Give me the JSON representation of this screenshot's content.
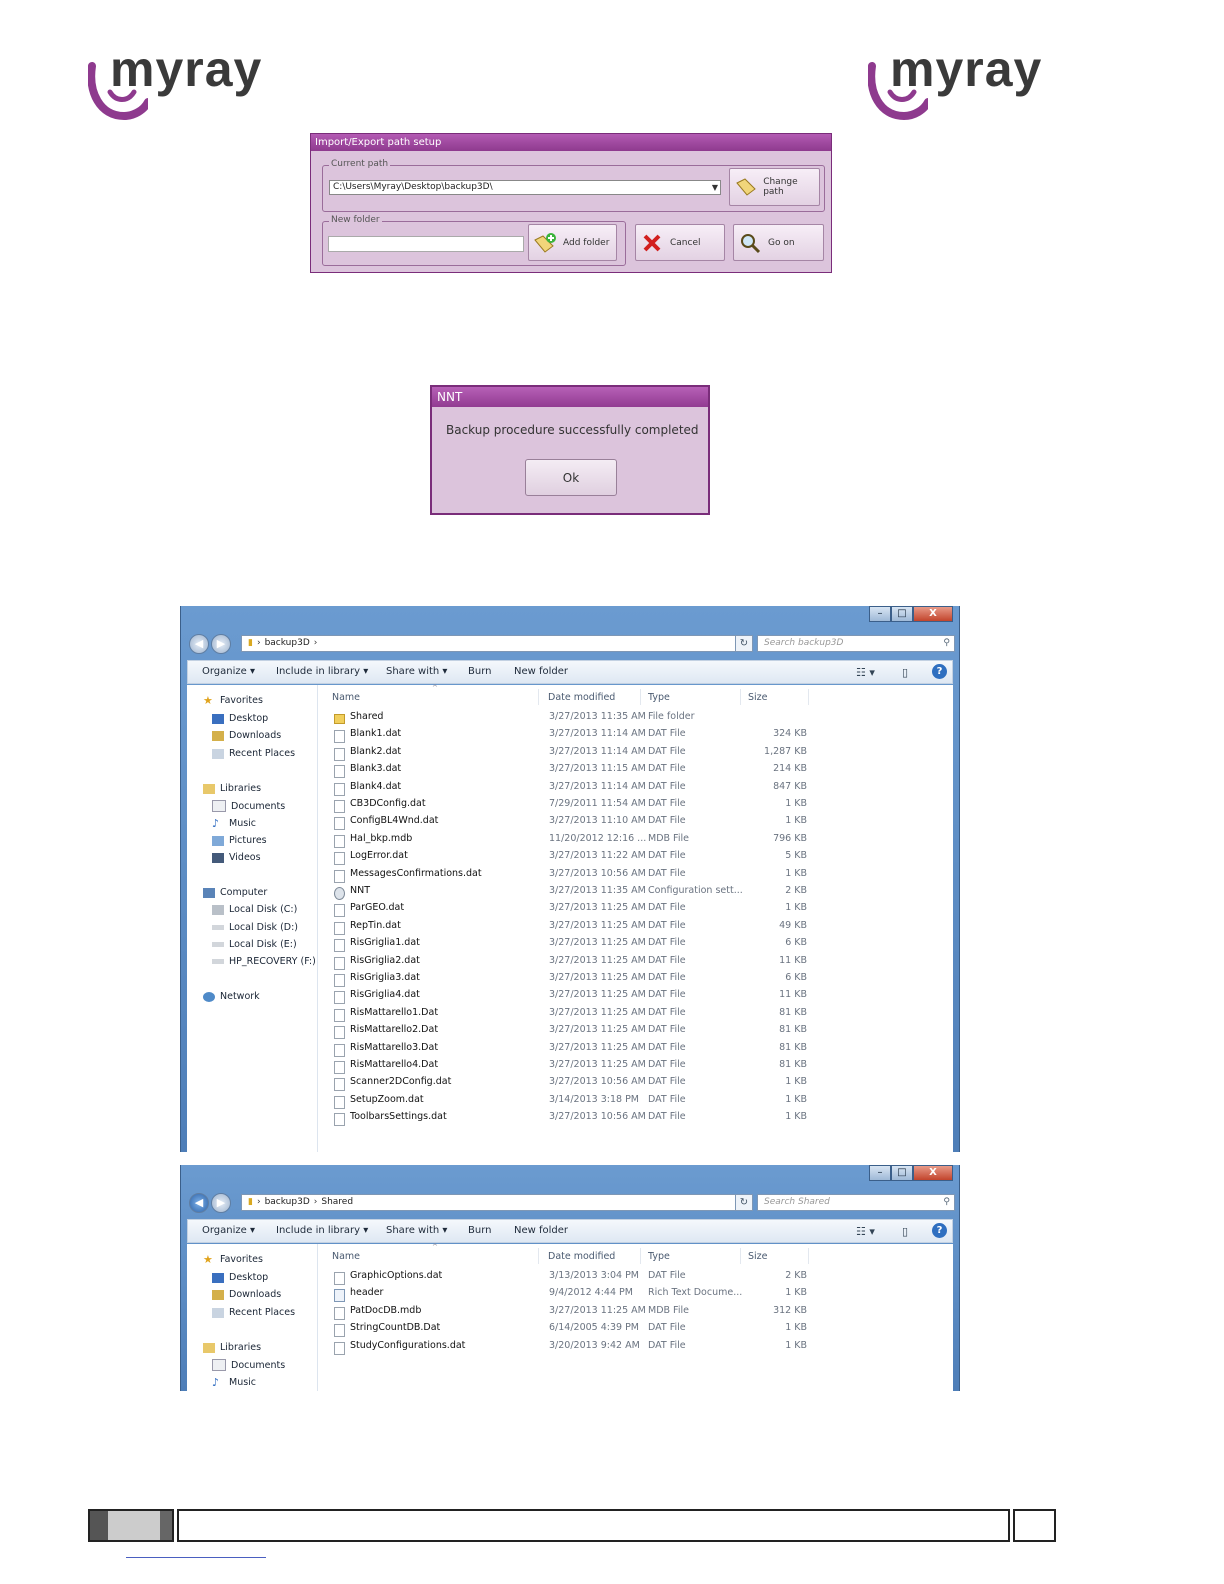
{
  "brand": {
    "logo_text": "myray",
    "logo_color": "#8e3a8e"
  },
  "import_export_dialog": {
    "title": "Import/Export path setup",
    "current_path_label": "Current path",
    "current_path_value": "C:\\Users\\Myray\\Desktop\\backup3D\\",
    "change_path_button": "Change path",
    "new_folder_label": "New folder",
    "new_folder_value": "",
    "add_folder_button": "Add folder",
    "cancel_button": "Cancel",
    "go_on_button": "Go on"
  },
  "message_dialog": {
    "title": "NNT",
    "message": "Backup procedure successfully completed",
    "ok_button": "Ok"
  },
  "explorer": {
    "window_buttons": {
      "minimize": "–",
      "maximize": "□",
      "close": "X"
    },
    "commands": {
      "organize": "Organize ▾",
      "include_in_library": "Include in library ▾",
      "share_with": "Share with ▾",
      "burn": "Burn",
      "new_folder": "New folder",
      "help": "?"
    },
    "columns": {
      "name": "Name",
      "date": "Date modified",
      "type": "Type",
      "size": "Size"
    },
    "nav_pane": {
      "favorites": "Favorites",
      "desktop": "Desktop",
      "downloads": "Downloads",
      "recent_places": "Recent Places",
      "libraries": "Libraries",
      "documents": "Documents",
      "music": "Music",
      "pictures": "Pictures",
      "videos": "Videos",
      "computer": "Computer",
      "disk_c": "Local Disk (C:)",
      "disk_d": "Local Disk (D:)",
      "disk_e": "Local Disk (E:)",
      "recovery": "HP_RECOVERY (F:)",
      "network": "Network"
    }
  },
  "window1": {
    "breadcrumb": [
      "backup3D"
    ],
    "search_placeholder": "Search backup3D",
    "files": [
      {
        "name": "Shared",
        "date": "3/27/2013 11:35 AM",
        "type": "File folder",
        "size": "",
        "icon": "folder-icon"
      },
      {
        "name": "Blank1.dat",
        "date": "3/27/2013 11:14 AM",
        "type": "DAT File",
        "size": "324 KB",
        "icon": "file-icon"
      },
      {
        "name": "Blank2.dat",
        "date": "3/27/2013 11:14 AM",
        "type": "DAT File",
        "size": "1,287 KB",
        "icon": "file-icon"
      },
      {
        "name": "Blank3.dat",
        "date": "3/27/2013 11:15 AM",
        "type": "DAT File",
        "size": "214 KB",
        "icon": "file-icon"
      },
      {
        "name": "Blank4.dat",
        "date": "3/27/2013 11:14 AM",
        "type": "DAT File",
        "size": "847 KB",
        "icon": "file-icon"
      },
      {
        "name": "CB3DConfig.dat",
        "date": "7/29/2011 11:54 AM",
        "type": "DAT File",
        "size": "1 KB",
        "icon": "file-icon"
      },
      {
        "name": "ConfigBL4Wnd.dat",
        "date": "3/27/2013 11:10 AM",
        "type": "DAT File",
        "size": "1 KB",
        "icon": "file-icon"
      },
      {
        "name": "Hal_bkp.mdb",
        "date": "11/20/2012 12:16 ...",
        "type": "MDB File",
        "size": "796 KB",
        "icon": "file-icon"
      },
      {
        "name": "LogError.dat",
        "date": "3/27/2013 11:22 AM",
        "type": "DAT File",
        "size": "5 KB",
        "icon": "file-icon"
      },
      {
        "name": "MessagesConfirmations.dat",
        "date": "3/27/2013 10:56 AM",
        "type": "DAT File",
        "size": "1 KB",
        "icon": "file-icon"
      },
      {
        "name": "NNT",
        "date": "3/27/2013 11:35 AM",
        "type": "Configuration sett...",
        "size": "2 KB",
        "icon": "config-icon"
      },
      {
        "name": "ParGEO.dat",
        "date": "3/27/2013 11:25 AM",
        "type": "DAT File",
        "size": "1 KB",
        "icon": "file-icon"
      },
      {
        "name": "RepTin.dat",
        "date": "3/27/2013 11:25 AM",
        "type": "DAT File",
        "size": "49 KB",
        "icon": "file-icon"
      },
      {
        "name": "RisGriglia1.dat",
        "date": "3/27/2013 11:25 AM",
        "type": "DAT File",
        "size": "6 KB",
        "icon": "file-icon"
      },
      {
        "name": "RisGriglia2.dat",
        "date": "3/27/2013 11:25 AM",
        "type": "DAT File",
        "size": "11 KB",
        "icon": "file-icon"
      },
      {
        "name": "RisGriglia3.dat",
        "date": "3/27/2013 11:25 AM",
        "type": "DAT File",
        "size": "6 KB",
        "icon": "file-icon"
      },
      {
        "name": "RisGriglia4.dat",
        "date": "3/27/2013 11:25 AM",
        "type": "DAT File",
        "size": "11 KB",
        "icon": "file-icon"
      },
      {
        "name": "RisMattarello1.Dat",
        "date": "3/27/2013 11:25 AM",
        "type": "DAT File",
        "size": "81 KB",
        "icon": "file-icon"
      },
      {
        "name": "RisMattarello2.Dat",
        "date": "3/27/2013 11:25 AM",
        "type": "DAT File",
        "size": "81 KB",
        "icon": "file-icon"
      },
      {
        "name": "RisMattarello3.Dat",
        "date": "3/27/2013 11:25 AM",
        "type": "DAT File",
        "size": "81 KB",
        "icon": "file-icon"
      },
      {
        "name": "RisMattarello4.Dat",
        "date": "3/27/2013 11:25 AM",
        "type": "DAT File",
        "size": "81 KB",
        "icon": "file-icon"
      },
      {
        "name": "Scanner2DConfig.dat",
        "date": "3/27/2013 10:56 AM",
        "type": "DAT File",
        "size": "1 KB",
        "icon": "file-icon"
      },
      {
        "name": "SetupZoom.dat",
        "date": "3/14/2013 3:18 PM",
        "type": "DAT File",
        "size": "1 KB",
        "icon": "file-icon"
      },
      {
        "name": "ToolbarsSettings.dat",
        "date": "3/27/2013 10:56 AM",
        "type": "DAT File",
        "size": "1 KB",
        "icon": "file-icon"
      }
    ]
  },
  "window2": {
    "breadcrumb": [
      "backup3D",
      "Shared"
    ],
    "search_placeholder": "Search Shared",
    "files": [
      {
        "name": "GraphicOptions.dat",
        "date": "3/13/2013 3:04 PM",
        "type": "DAT File",
        "size": "2 KB",
        "icon": "file-icon"
      },
      {
        "name": "header",
        "date": "9/4/2012 4:44 PM",
        "type": "Rich Text Docume...",
        "size": "1 KB",
        "icon": "rtf-icon"
      },
      {
        "name": "PatDocDB.mdb",
        "date": "3/27/2013 11:25 AM",
        "type": "MDB File",
        "size": "312 KB",
        "icon": "file-icon"
      },
      {
        "name": "StringCountDB.Dat",
        "date": "6/14/2005 4:39 PM",
        "type": "DAT File",
        "size": "1 KB",
        "icon": "file-icon"
      },
      {
        "name": "StudyConfigurations.dat",
        "date": "3/20/2013 9:42 AM",
        "type": "DAT File",
        "size": "1 KB",
        "icon": "file-icon"
      }
    ]
  }
}
